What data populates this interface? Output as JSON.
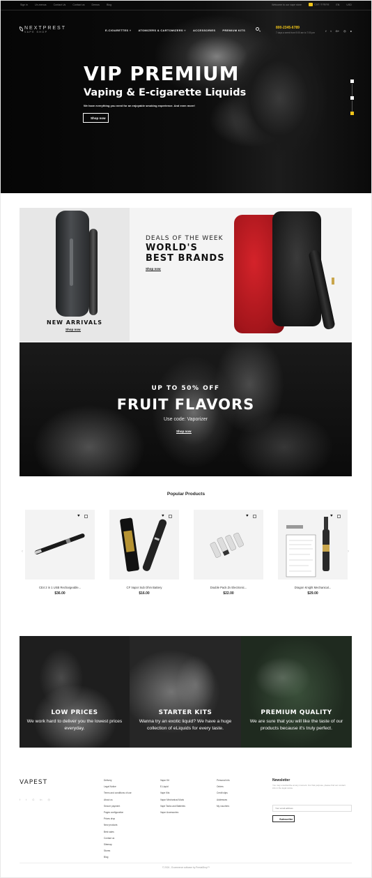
{
  "topbar": {
    "links": [
      "Sign in",
      "Un-menus",
      "Contact Us",
      "Contact us",
      "Demos",
      "Blog"
    ],
    "welcome": "Welcome to our vape store",
    "cart": "Cart / 0 items",
    "lang": "EN",
    "currency": "USD"
  },
  "header": {
    "logo_main": "NEXTPREST",
    "logo_sub": "VAPE SHOP",
    "nav": [
      "E-CIGARETTES ˅",
      "ATOMIZERS & CARTOMIZERS ˅",
      "ACCESSORIES",
      "PREMIUM KITS"
    ],
    "phone": "800-2345-6789",
    "hours": "7 days a week from 9:00 am to 7:00 pm",
    "socials": [
      "f",
      "t",
      "G+",
      "◎",
      "●"
    ]
  },
  "hero": {
    "title": "VIP PREMIUM",
    "subtitle": "Vaping & E-cigarette Liquids",
    "desc": "We have everything you need for an enjoyable smoking experience. And even more!",
    "button": "Shop now"
  },
  "banners": {
    "left_title": "NEW ARRIVALS",
    "left_link": "Shop now",
    "right_kicker": "DEALS OF THE WEEK",
    "right_title_1": "WORLD'S",
    "right_title_2": "BEST BRANDS",
    "right_link": "Shop now"
  },
  "fruit": {
    "kicker": "UP TO 50% OFF",
    "title": "FRUIT FLAVORS",
    "code": "Use code: Vaporizer",
    "link": "Shop now"
  },
  "products": {
    "section_title": "Popular Products",
    "items": [
      {
        "name": "CE4 2 in 1 USB Rechargeable...",
        "price": "$36.00"
      },
      {
        "name": "CF Vapor Sub Ohm Battery",
        "price": "$16.00"
      },
      {
        "name": "Double Pack Zv Electronic...",
        "price": "$22.00"
      },
      {
        "name": "Dragon Knight Mechanical...",
        "price": "$29.00"
      }
    ]
  },
  "features": [
    {
      "title": "LOW PRICES",
      "text": "We work hard to deliver you the lowest prices everyday."
    },
    {
      "title": "STARTER KITS",
      "text": "Wanna try an exotic liquid? We have a huge collection of eLiquids for every taste."
    },
    {
      "title": "PREMIUM QUALITY",
      "text": "We are sure that you will like the taste of our products because it's truly perfect."
    }
  ],
  "footer": {
    "logo": "VAPEST",
    "socials": [
      "f",
      "t",
      "G",
      "in",
      "◎"
    ],
    "col1": [
      "Delivery",
      "Legal Notice",
      "Terms and conditions of use",
      "About us",
      "Secure payment",
      "Pages configuration",
      "Prices drop",
      "New products",
      "Best sales",
      "Contact us",
      "Sitemap",
      "Stores",
      "Blog"
    ],
    "col2": [
      "Vapor Kit",
      "E-Liquid",
      "Vape Kits",
      "Vapor Mechanical Mods",
      "Vape Tanks and Batteries",
      "Vapor Accessories"
    ],
    "col3": [
      "Personal info",
      "Orders",
      "Credit slips",
      "Addresses",
      "My vouchers"
    ],
    "newsletter_title": "Newsletter",
    "newsletter_text": "You may unsubscribe at any moment. For that purpose, please find our contact info in the legal notice.",
    "newsletter_placeholder": "Your email address",
    "newsletter_button": "Subscribe",
    "copyright": "© 2024 - Ecommerce software by PrestaShop™"
  }
}
